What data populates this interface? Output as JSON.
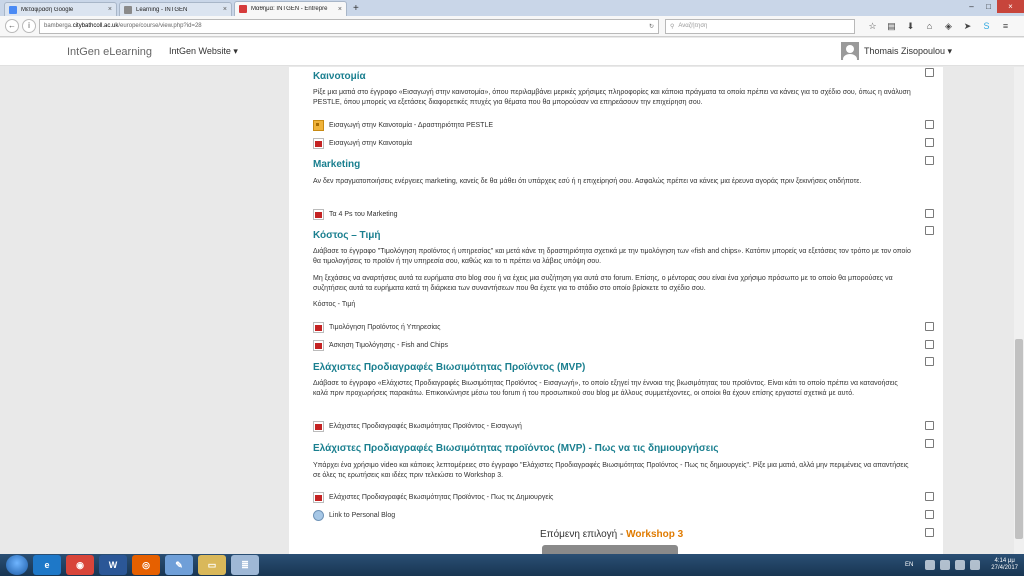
{
  "browser": {
    "tabs": [
      {
        "label": "Μετάφραση Google",
        "color": "#4a8af4",
        "active": false
      },
      {
        "label": "Learning - INTGEN",
        "color": "#8a8a8a",
        "active": false
      },
      {
        "label": "Μάθημα: INTGEN - Entrepre",
        "color": "#d63b3b",
        "active": true
      }
    ],
    "new_tab": "+",
    "url_prefix": "bamberga.",
    "url_host": "citybathcoll.ac.uk",
    "url_path": "/europe/course/view.php?id=28",
    "search_placeholder": "Αναζήτηση"
  },
  "site": {
    "brand": "IntGen eLearning",
    "menu": "IntGen Website ▾",
    "user": "Thomais Zisopoulou ▾"
  },
  "sections": [
    {
      "title": "Καινοτομία",
      "paragraphs": [
        "Ρίξε μια ματιά στο έγγραφο «Εισαγωγή στην καινοτομία», όπου περιλαμβάνει μερικές χρήσιμες πληροφορίες και κάποια πράγματα τα οποία πρέπει να κάνεις για το σχέδιο σου, όπως η ανάλυση PESTLE, όπου μπορείς να εξετάσεις διαφορετικές πτυχές για θέματα που θα μπορούσαν να επηρεάσουν την επιχείρηση σου."
      ],
      "resources": [
        {
          "label": "Εισαγωγή στην Καινοτομία - Δραστηριότητα PESTLE",
          "icon": "activity-icon"
        },
        {
          "label": "Εισαγωγή στην Καινοτομία",
          "icon": "pdf-icon"
        }
      ]
    },
    {
      "title": "Marketing",
      "paragraphs": [
        "Αν δεν πραγματοποιήσεις ενέργειες marketing, κανείς δε θα μάθει ότι υπάρχεις εσύ ή η επιχείρησή σου. Ασφαλώς πρέπει να κάνεις μια έρευνα αγοράς πριν ξεκινήσεις οτιδήποτε."
      ],
      "resources": [
        {
          "label": "Τα 4 Ps του Marketing",
          "icon": "pdf-icon"
        }
      ]
    },
    {
      "title": "Κόστος – Τιμή",
      "paragraphs": [
        "Διάβασε το έγγραφο \"Τιμολόγηση προϊόντος ή υπηρεσίας\" και μετά κάνε τη δραστηριότητα σχετικά με την τιμολόγηση των «fish and chips». Κατόπιν μπορείς να εξετάσεις τον τρόπο με τον οποίο θα τιμολογήσεις το προϊόν ή την υπηρεσία σου, καθώς και το τι πρέπει να λάβεις υπόψη σου.",
        "Μη ξεχάσεις να αναρτήσεις αυτά τα ευρήματα στο blog σου ή να έχεις μια συζήτηση για αυτά στο forum. Επίσης, ο μέντορας σου είναι ένα χρήσιμο πρόσωπο με το οποίο θα μπορούσες να συζητήσεις αυτά τα ευρήματα κατά τη διάρκεια των συναντήσεων που θα έχετε για το στάδιο στο οποίο βρίσκετε το σχέδιο σου.",
        "Κόστος - Τιμή"
      ],
      "resources": [
        {
          "label": "Τιμολόγηση Προϊόντος ή Υπηρεσίας",
          "icon": "pdf-icon"
        },
        {
          "label": "Άσκηση Τιμολόγησης - Fish and Chips",
          "icon": "pdf-icon"
        }
      ]
    },
    {
      "title": "Ελάχιστες Προδιαγραφές Βιωσιμότητας Προϊόντος (MVP)",
      "paragraphs": [
        "Διάβασε το έγγραφο «Ελάχιστες Προδιαγραφές Βιωσιμότητας Προϊόντος - Εισαγωγή», το οποίο εξηγεί την έννοια της βιωσιμότητας του προϊόντος. Είναι κάτι το οποίο πρέπει να κατανοήσεις καλά πριν προχωρήσεις παρακάτω. Επικοινώνησε μέσω του forum ή του προσωπικού σου blog με άλλους συμμετέχοντες, οι οποίοι θα έχουν επίσης εργαστεί σχετικά με αυτό."
      ],
      "resources": [
        {
          "label": "Ελάχιστες Προδιαγραφές Βιωσιμότητας Προϊόντος - Εισαγωγή",
          "icon": "pdf-icon"
        }
      ]
    },
    {
      "title": "Ελάχιστες Προδιαγραφές Βιωσιμότητας προϊόντος (MVP) - Πως να τις δημιουργήσεις",
      "paragraphs": [
        "Υπάρχει ένα χρήσιμο video και κάποιες λεπτομέρειες στο έγγραφο \"Ελάχιστες Προδιαγραφές Βιωσιμότητας Προϊόντος - Πως τις δημιουργείς\". Ρίξε μια ματιά, αλλά μην περιμένεις να απαντήσεις σε όλες τις ερωτήσεις και ιδέες πριν τελειώσει το Workshop 3."
      ],
      "resources": [
        {
          "label": "Ελάχιστες Προδιαγραφές Βιωσιμότητας Προϊόντος - Πως τις Δημιουργείς",
          "icon": "pdf-icon"
        },
        {
          "label": "Link to Personal Blog",
          "icon": "url-icon"
        }
      ]
    }
  ],
  "next": {
    "prefix": "Επόμενη επιλογή - ",
    "target": "Workshop 3"
  },
  "taskbar": {
    "apps": [
      "chrome",
      "W",
      "firefox",
      "explorer",
      "folder",
      "notepad"
    ],
    "lang": "EN",
    "time": "4:14 μμ",
    "date": "27/4/2017"
  }
}
